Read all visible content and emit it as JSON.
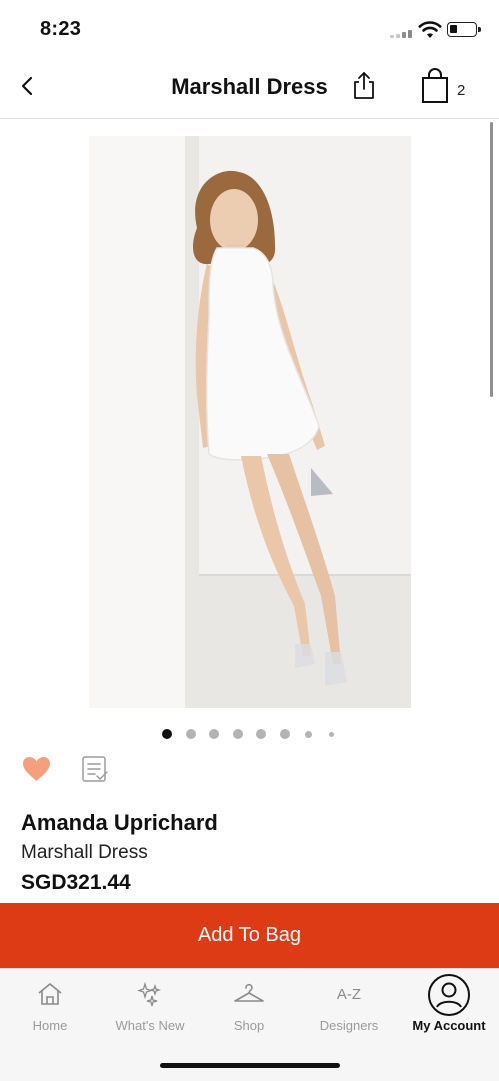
{
  "status_bar": {
    "time": "8:23"
  },
  "header": {
    "title": "Marshall Dress",
    "bag_count": "2"
  },
  "carousel": {
    "total": 8,
    "active": 0
  },
  "product": {
    "brand": "Amanda Uprichard",
    "name": "Marshall Dress",
    "price": "SGD321.44",
    "favorited": true
  },
  "actions": {
    "add_to_bag": "Add To Bag"
  },
  "tabbar": {
    "items": [
      {
        "label": "Home",
        "icon": "home-icon"
      },
      {
        "label": "What's New",
        "icon": "sparkles-icon"
      },
      {
        "label": "Shop",
        "icon": "hanger-icon"
      },
      {
        "label": "Designers",
        "icon": "a-z-icon",
        "glyph": "A-Z"
      },
      {
        "label": "My Account",
        "icon": "account-icon"
      }
    ],
    "active_index": 4
  },
  "colors": {
    "accent": "#dd3b16",
    "heart": "#f4a07c",
    "tab_inactive": "#9a9a9a"
  }
}
